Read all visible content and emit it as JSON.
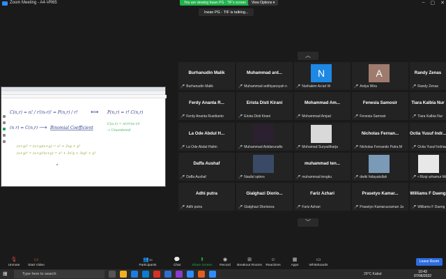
{
  "window": {
    "title": "Zoom Meeting - A4-VR65"
  },
  "banner": {
    "sharing": "You are viewing Irwan PG - TIF's screen",
    "view_options": "View Options ▾"
  },
  "talking": "Irwan PG - TIF is talking...",
  "participants": [
    {
      "big": "Burhanudin Malik",
      "small": "Burhanudin Malik"
    },
    {
      "big": "Muhammad  ard...",
      "small": "Muhammad ardhiyansyah n"
    },
    {
      "big": "",
      "small": "Nurhakim As'ad W",
      "avatar_letter": "N",
      "avatar_color": "#1e88e5"
    },
    {
      "big": "",
      "small": "Ardya Wira",
      "avatar_letter": "A",
      "avatar_color": "#9e7b6e"
    },
    {
      "big": "Randy Zenas",
      "small": "Randy Zenas"
    },
    {
      "big": "Ferdy Ananta R...",
      "small": "Ferdy Ananta Rusdianto"
    },
    {
      "big": "Erista Disti Kirani",
      "small": "Erista Disti Kirani"
    },
    {
      "big": "Mohammad  Am...",
      "small": "Mohammad Amjad"
    },
    {
      "big": "Fenesia Samosir",
      "small": "Fenesia Samosir"
    },
    {
      "big": "Tiara Kalbia Nur",
      "small": "Tiara Kalbia Nur"
    },
    {
      "big": "La Ode Abdul H...",
      "small": "La Ode Abdul Halim"
    },
    {
      "big": "",
      "small": "Muhammad Aiddarunafis",
      "avatar_color": "#2a2030"
    },
    {
      "big": "",
      "small": "Mohamad Suryadiharja",
      "avatar_color": "#d9d9d9"
    },
    {
      "big": "Nicholas  Fernan...",
      "small": "Nicholas Fernando Putra M"
    },
    {
      "big": "Octia Yusuf Indr...",
      "small": "Octia Yusuf Indriawan"
    },
    {
      "big": "Daffa Aushaf",
      "small": "Daffa Aushaf"
    },
    {
      "big": "",
      "small": "Naufal sptnrs",
      "avatar_color": "#3a4a66"
    },
    {
      "big": "muhammad  ten...",
      "small": "muhammad tengku"
    },
    {
      "big": "",
      "small": "dwiki hidayatullah",
      "avatar_color": "#7a9ab8"
    },
    {
      "big": "",
      "small": "• Rizqi arhamur Ma'ruf",
      "avatar_color": "#e8e8e8"
    },
    {
      "big": "Adhi putra",
      "small": "Adhi putra"
    },
    {
      "big": "Gialghazi  Diorio...",
      "small": "Gialghazi Diorionza"
    },
    {
      "big": "Fariz Azhari",
      "small": "Fariz Azhari"
    },
    {
      "big": "Prasetyo  Kamar...",
      "small": "Prasetyo Kamaruzzaman Ja"
    },
    {
      "big": "Williams F Daeng",
      "small": "Williams F Daeng"
    }
  ],
  "whiteboard": {
    "line1_left": "C(n,r) = n! / r!(n-r)!",
    "line1_mid": "= P(n,r) / r!",
    "line1_arrow": "⟺",
    "line1_right": "P(n,r) = r! C(n,r)",
    "line2_left": "(n r) = C(n,r)",
    "line2_arrow": "⟶",
    "line2_label": "Binomial Coefficient",
    "line2_note": "C(n,r) = n!/r!(n-r)!",
    "line2_note2": "→ Unordered",
    "line3a": "(x+y)² = (x+y)(x+y) = x² + 2xy + y²",
    "line3b": "(x+y)³ = (x+y)²(x+y) = x³ + 3x²y + 3xy² + y³"
  },
  "toolbar": {
    "unmute": "Unmute",
    "start_video": "Start Video",
    "participants": "Participants",
    "participants_count": "30",
    "chat": "Chat",
    "share_screen": "Share Screen",
    "record": "Record",
    "breakout": "Breakout Rooms",
    "reactions": "Reactions",
    "apps": "Apps",
    "whiteboards": "Whiteboards",
    "leave": "Leave Room"
  },
  "taskbar": {
    "search_placeholder": "Type here to search",
    "weather": "29°C  Kabut",
    "time": "10:43",
    "date": "07/06/2022"
  }
}
